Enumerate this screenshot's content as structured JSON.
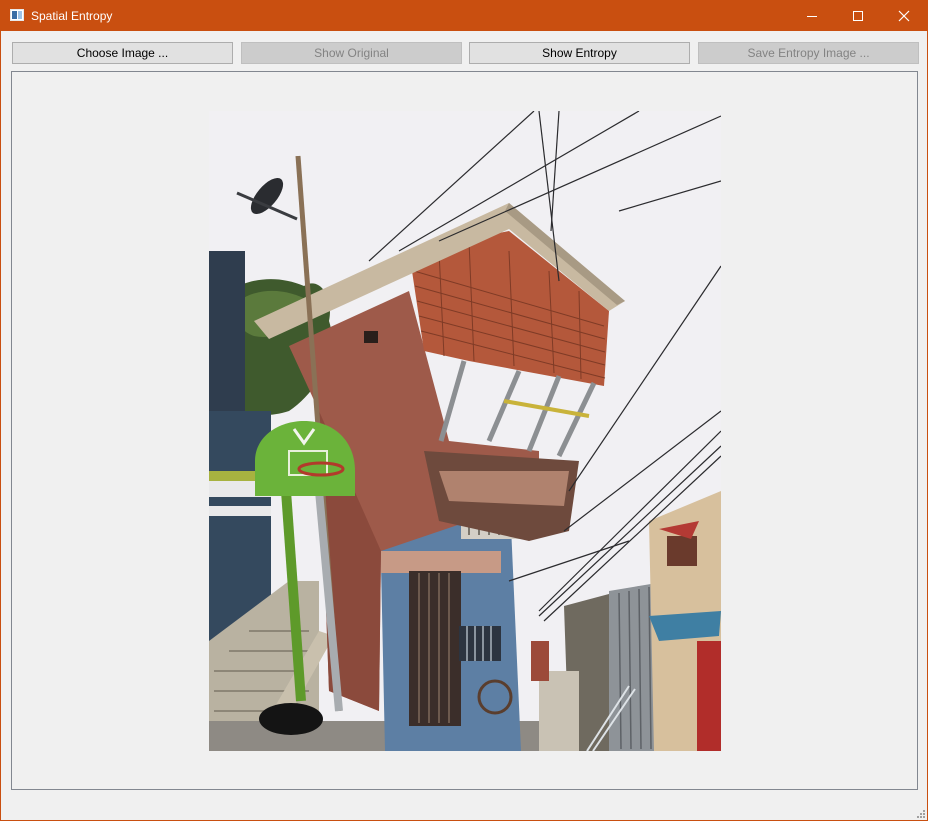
{
  "window": {
    "title": "Spatial Entropy",
    "accent_color": "#c94f10",
    "app_icon": "app-window-icon"
  },
  "title_bar_controls": {
    "minimize_icon": "minimize-icon",
    "maximize_icon": "maximize-icon",
    "close_icon": "close-icon"
  },
  "toolbar": {
    "buttons": [
      {
        "label": "Choose Image ...",
        "enabled": true
      },
      {
        "label": "Show Original",
        "enabled": false
      },
      {
        "label": "Show Entropy",
        "enabled": true
      },
      {
        "label": "Save Entropy Image ...",
        "enabled": false
      }
    ]
  },
  "image_view": {
    "content": "photo of a leaning multi-storey house with a basketball hoop, power lines and stairs"
  },
  "status": {
    "size_grip_icon": "resize-grip-icon"
  }
}
